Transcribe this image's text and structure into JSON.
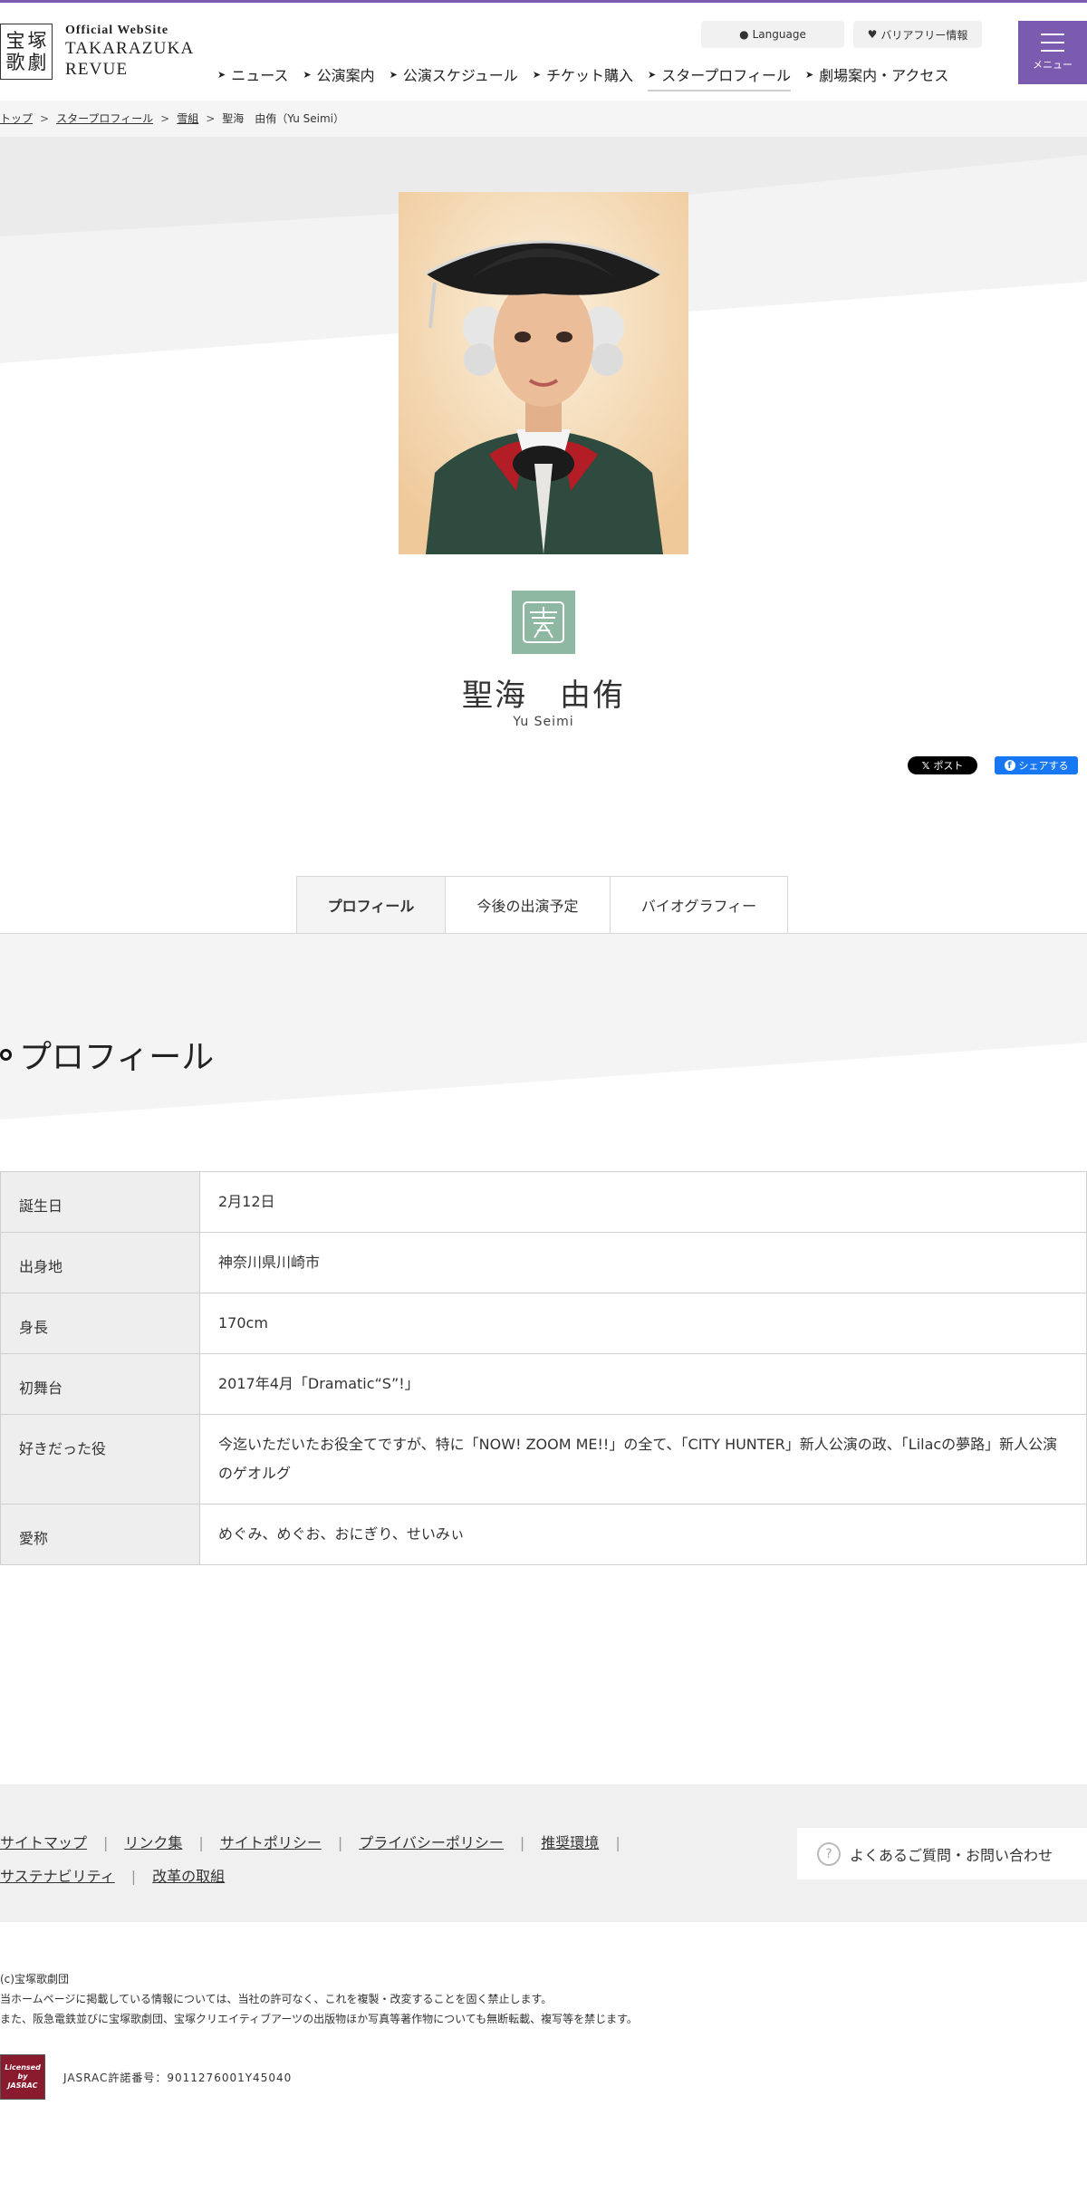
{
  "header": {
    "logo_seal": [
      "宝",
      "塚",
      "歌",
      "劇"
    ],
    "logo_small": "Official WebSite",
    "logo_line1": "TAKARAZUKA",
    "logo_line2": "REVUE",
    "language_label": "Language",
    "barrier_free_label": "バリアフリー情報",
    "menu_label": "メニュー",
    "nav": [
      {
        "label": "ニュース"
      },
      {
        "label": "公演案内"
      },
      {
        "label": "公演スケジュール"
      },
      {
        "label": "チケット購入"
      },
      {
        "label": "スタープロフィール"
      },
      {
        "label": "劇場案内・アクセス"
      }
    ]
  },
  "breadcrumb": {
    "items": [
      "トップ",
      "スタープロフィール",
      "雪組"
    ],
    "current": "聖海　由侑（Yu Seimi）",
    "sep": ">"
  },
  "star": {
    "name": "聖海　由侑",
    "name_roman": "Yu Seimi"
  },
  "share": {
    "x_label": "ポスト",
    "fb_label": "シェアする"
  },
  "tabs": [
    {
      "label": "プロフィール"
    },
    {
      "label": "今後の出演予定"
    },
    {
      "label": "バイオグラフィー"
    }
  ],
  "profile": {
    "title": "プロフィール",
    "rows": [
      {
        "key": "誕生日",
        "value": "2月12日"
      },
      {
        "key": "出身地",
        "value": "神奈川県川崎市"
      },
      {
        "key": "身長",
        "value": "170cm"
      },
      {
        "key": "初舞台",
        "value": "2017年4月「Dramatic“S”!」"
      },
      {
        "key": "好きだった役",
        "value": "今迄いただいたお役全てですが、特に「NOW! ZOOM ME!!」の全て、「CITY HUNTER」新人公演の政、「Lilacの夢路」新人公演のゲオルグ"
      },
      {
        "key": "愛称",
        "value": "めぐみ、めぐお、おにぎり、せいみぃ"
      }
    ]
  },
  "footer": {
    "links_row1": [
      "サイトマップ",
      "リンク集",
      "サイトポリシー",
      "プライバシーポリシー",
      "推奨環境"
    ],
    "links_row2": [
      "サステナビリティ",
      "改革の取組"
    ],
    "faq_label": "よくあるご質問・お問い合わせ",
    "copyright": "(c)宝塚歌劇団",
    "notice1": "当ホームページに掲載している情報については、当社の許可なく、これを複製・改変することを固く禁止します。",
    "notice2": "また、阪急電鉄並びに宝塚歌劇団、宝塚クリエイティブアーツの出版物ほか写真等著作物についても無断転載、複写等を禁じます。",
    "jasrac_logo": [
      "Licensed",
      "by",
      "JASRAC"
    ],
    "jasrac_text": "JASRAC許諾番号：9011276001Y45040"
  }
}
